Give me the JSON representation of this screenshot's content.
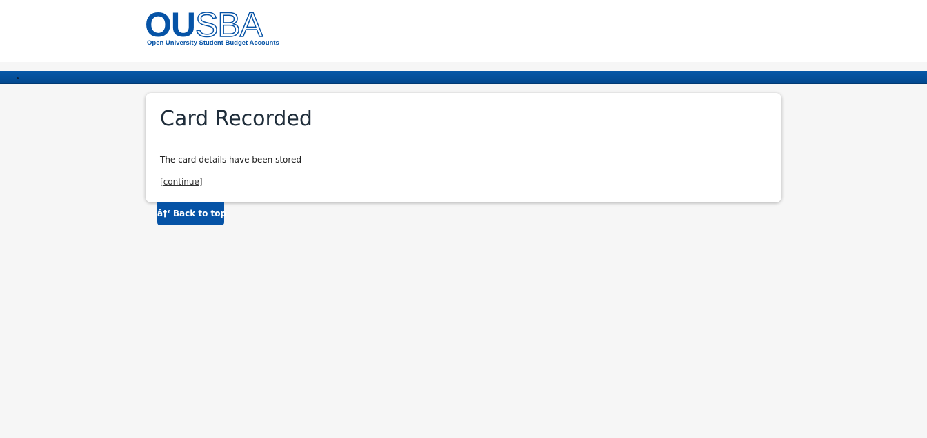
{
  "header": {
    "logo": {
      "solid_text": "OU",
      "outline_text": "SBA",
      "tagline": "Open University Student Budget Accounts"
    }
  },
  "card": {
    "title": "Card Recorded",
    "message": "The card details have been stored",
    "link_open_bracket": "[",
    "link_label": "continue",
    "link_close_bracket": "]"
  },
  "back_to_top": {
    "label": "â†‘ Back to top"
  },
  "colors": {
    "brand_blue": "#0653a6",
    "page_background": "#f6f6f6"
  }
}
